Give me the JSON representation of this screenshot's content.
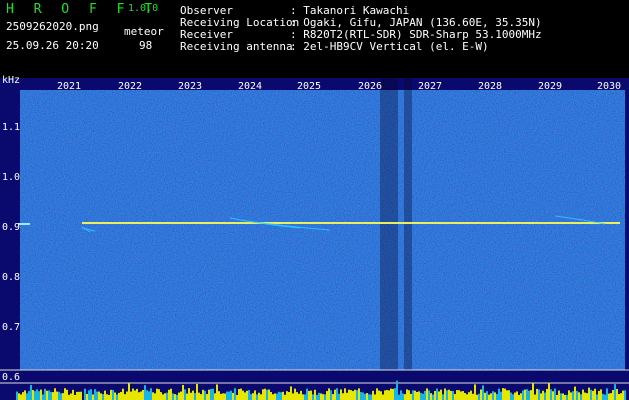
{
  "app": {
    "brand": "H R O F F T",
    "version": "1.0.0",
    "filename": "2509262020.png",
    "datetime": "25.09.26 20:20",
    "meteor_label": "meteor",
    "meteor_count": "98"
  },
  "info": [
    {
      "label": "Observer",
      "value": ": Takanori Kawachi"
    },
    {
      "label": "Receiving Location",
      "value": ": Ogaki, Gifu, JAPAN (136.60E, 35.35N)"
    },
    {
      "label": "Receiver",
      "value": ": R820T2(RTL-SDR) SDR-Sharp 53.1000MHz"
    },
    {
      "label": "Receiving antenna",
      "value": ": 2el-HB9CV Vertical (el. E-W)"
    }
  ],
  "axis": {
    "unit": "kHz",
    "y_ticks": [
      "1.1",
      "1.0",
      "0.9",
      "0.8",
      "0.7",
      "0.6"
    ],
    "x_ticks": [
      "2021",
      "2022",
      "2023",
      "2024",
      "2025",
      "2026",
      "2027",
      "2028",
      "2029",
      "2030"
    ]
  },
  "colors": {
    "background": "#000000",
    "spectrum_bg": "#0a0a6e",
    "carrier": "#e8f060",
    "brand": "#19e619",
    "level_bar": "#e6e600",
    "level_bar_low": "#18b4e6"
  }
}
